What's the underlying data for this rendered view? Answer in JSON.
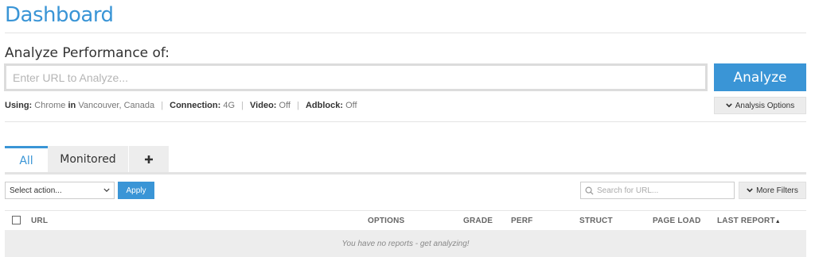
{
  "page": {
    "title": "Dashboard"
  },
  "analyze": {
    "label": "Analyze Performance of:",
    "url_placeholder": "Enter URL to Analyze...",
    "url_value": "",
    "button_label": "Analyze",
    "options_label": "Analysis Options",
    "options_icon": "chevron-down-icon"
  },
  "settings": {
    "using_label": "Using:",
    "browser": "Chrome",
    "in_label": "in",
    "location": "Vancouver, Canada",
    "connection_label": "Connection:",
    "connection": "4G",
    "video_label": "Video:",
    "video": "Off",
    "adblock_label": "Adblock:",
    "adblock": "Off",
    "separator": "|"
  },
  "tabs": [
    {
      "label": "All",
      "active": true
    },
    {
      "label": "Monitored",
      "active": false
    },
    {
      "label": "+",
      "icon": "plus-icon"
    }
  ],
  "toolbar": {
    "select_value": "Select action...",
    "apply_label": "Apply",
    "search_placeholder": "Search for URL...",
    "search_icon": "search-icon",
    "more_filters_label": "More Filters"
  },
  "table": {
    "columns": [
      "URL",
      "OPTIONS",
      "GRADE",
      "PERF",
      "STRUCT",
      "PAGE LOAD",
      "LAST REPORT"
    ],
    "sort_column": "LAST REPORT",
    "sort_indicator": "▲",
    "empty_message": "You have no reports - get analyzing!"
  },
  "colors": {
    "accent": "#3a95d6",
    "button_gray": "#ececec",
    "border": "#dcdcdc"
  }
}
